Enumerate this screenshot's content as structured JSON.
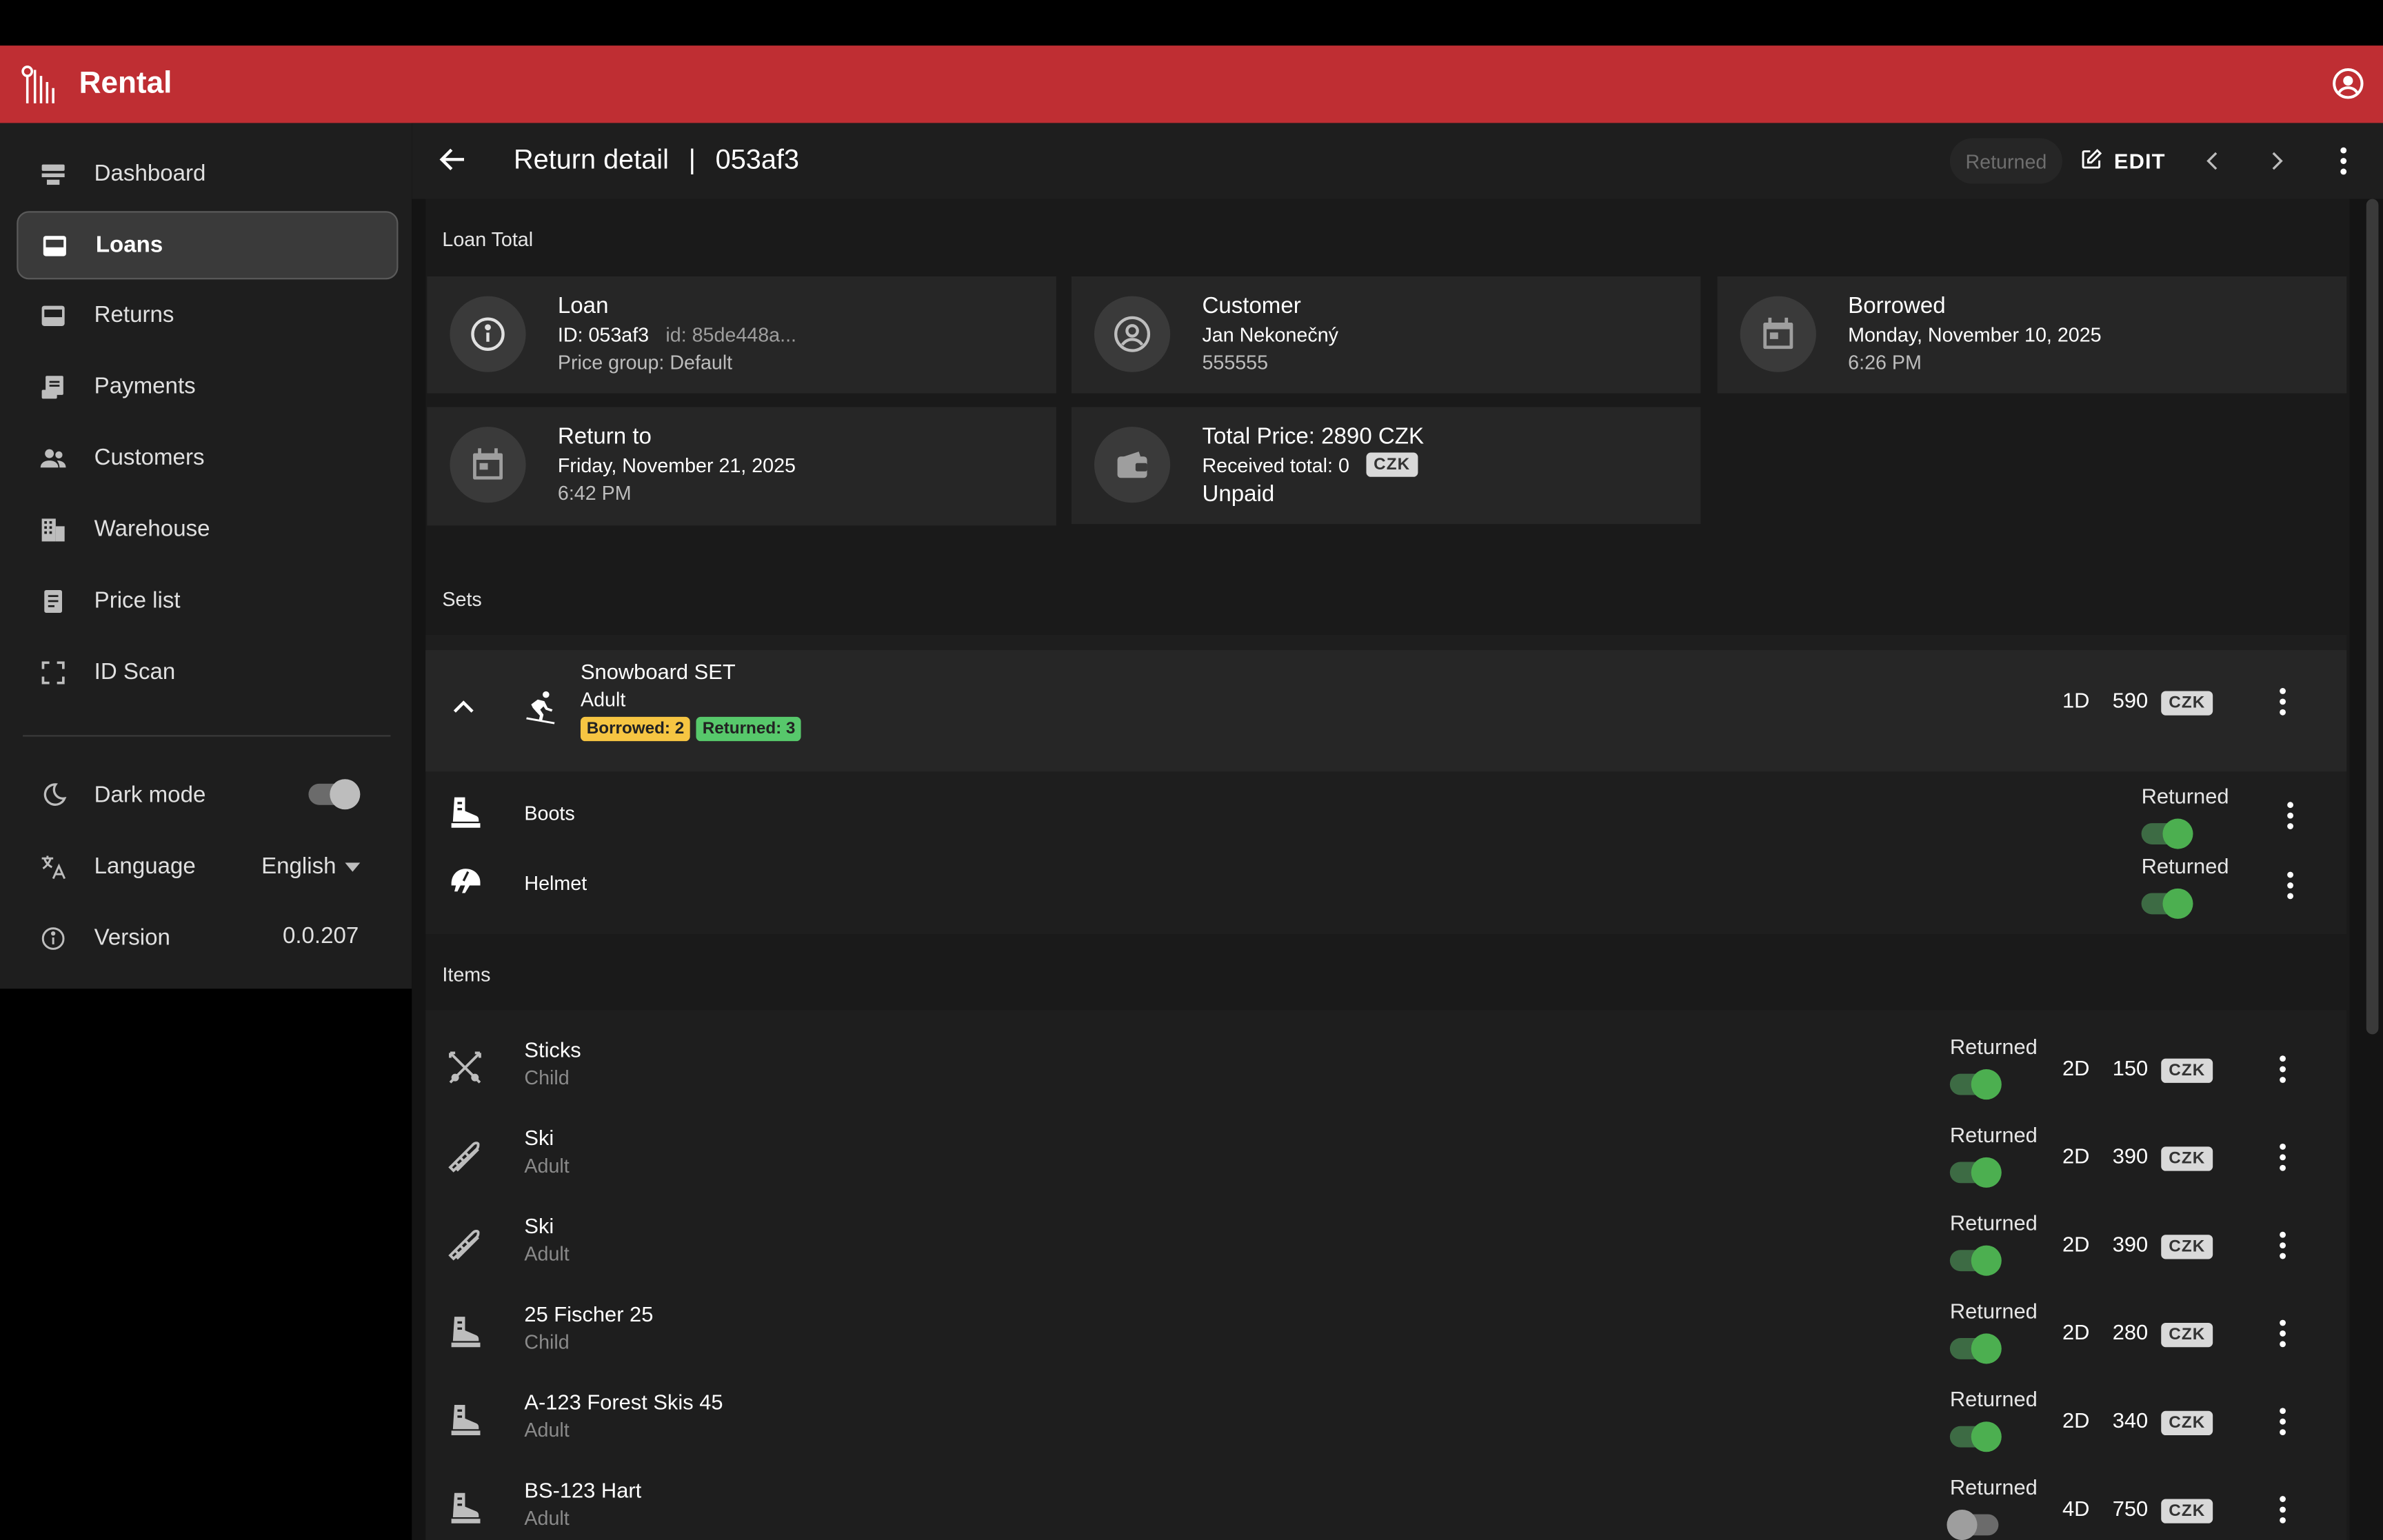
{
  "app": {
    "title": "Rental"
  },
  "sidebar": {
    "items": [
      {
        "label": "Dashboard",
        "icon": "dashboard-icon"
      },
      {
        "label": "Loans",
        "icon": "inbox-icon",
        "active": true
      },
      {
        "label": "Returns",
        "icon": "inbox-icon"
      },
      {
        "label": "Payments",
        "icon": "receipt-icon"
      },
      {
        "label": "Customers",
        "icon": "people-icon"
      },
      {
        "label": "Warehouse",
        "icon": "building-icon"
      },
      {
        "label": "Price list",
        "icon": "document-icon"
      },
      {
        "label": "ID Scan",
        "icon": "scan-icon"
      }
    ],
    "dark_mode_label": "Dark mode",
    "dark_mode_on": true,
    "language_label": "Language",
    "language_value": "English",
    "version_label": "Version",
    "version_value": "0.0.207"
  },
  "header": {
    "title": "Return detail",
    "separator": "|",
    "id": "053af3",
    "status_chip": "Returned",
    "edit_label": "EDIT"
  },
  "loan_total": {
    "label": "Loan Total",
    "loan": {
      "title": "Loan",
      "id_line": "ID: 053af3",
      "uuid": "id: 85de448a...",
      "price_group": "Price group: Default"
    },
    "customer": {
      "title": "Customer",
      "name": "Jan Nekonečný",
      "phone": "555555"
    },
    "borrowed": {
      "title": "Borrowed",
      "date": "Monday, November 10, 2025",
      "time": "6:26 PM"
    },
    "return_to": {
      "title": "Return to",
      "date": "Friday, November 21, 2025",
      "time": "6:42 PM"
    },
    "total": {
      "title": "Total Price: 2890 CZK",
      "received": "Received total: 0",
      "currency": "CZK",
      "status": "Unpaid"
    }
  },
  "sets": {
    "label": "Sets",
    "set": {
      "name": "Snowboard SET",
      "category": "Adult",
      "borrowed_badge": "Borrowed: 2",
      "returned_badge": "Returned: 3",
      "duration": "1D",
      "price": "590",
      "currency": "CZK"
    },
    "parts": [
      {
        "name": "Boots",
        "icon": "boot-icon",
        "status_label": "Returned",
        "returned": true
      },
      {
        "name": "Helmet",
        "icon": "helmet-icon",
        "status_label": "Returned",
        "returned": true
      }
    ]
  },
  "items": {
    "label": "Items",
    "rows": [
      {
        "name": "Sticks",
        "category": "Child",
        "icon": "ski-poles-icon",
        "status_label": "Returned",
        "returned": true,
        "duration": "2D",
        "price": "150",
        "currency": "CZK"
      },
      {
        "name": "Ski",
        "category": "Adult",
        "icon": "skis-icon",
        "status_label": "Returned",
        "returned": true,
        "duration": "2D",
        "price": "390",
        "currency": "CZK"
      },
      {
        "name": "Ski",
        "category": "Adult",
        "icon": "skis-icon",
        "status_label": "Returned",
        "returned": true,
        "duration": "2D",
        "price": "390",
        "currency": "CZK"
      },
      {
        "name": "25 Fischer 25",
        "category": "Child",
        "icon": "boot-icon",
        "status_label": "Returned",
        "returned": true,
        "duration": "2D",
        "price": "280",
        "currency": "CZK"
      },
      {
        "name": "A-123 Forest Skis 45",
        "category": "Adult",
        "icon": "boot-icon",
        "status_label": "Returned",
        "returned": true,
        "duration": "2D",
        "price": "340",
        "currency": "CZK"
      },
      {
        "name": "BS-123 Hart",
        "category": "Adult",
        "icon": "boot-icon",
        "status_label": "Returned",
        "returned": false,
        "duration": "4D",
        "price": "750",
        "currency": "CZK"
      }
    ]
  },
  "colors": {
    "appbar": "#bf2e33",
    "toggle_on": "#4caf50",
    "badge_borrowed": "#f6c542",
    "badge_returned": "#57c86b"
  }
}
